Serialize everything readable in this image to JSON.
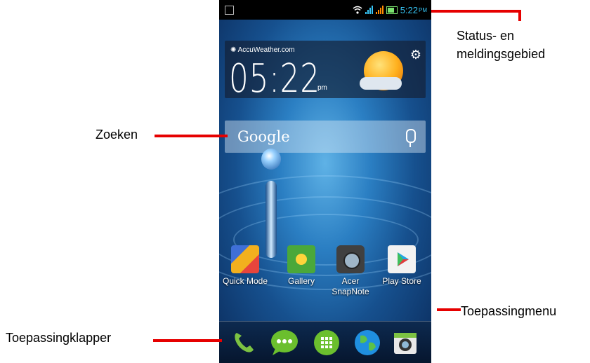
{
  "status_bar": {
    "time": "5:22",
    "ampm": "PM"
  },
  "widget": {
    "source": "AccuWeather.com",
    "time": "05:22",
    "suffix": "pm"
  },
  "search": {
    "label": "Google"
  },
  "apps": [
    {
      "label": "Quick Mode"
    },
    {
      "label": "Gallery"
    },
    {
      "label": "Acer SnapNote"
    },
    {
      "label": "Play Store"
    }
  ],
  "callouts": {
    "status": "Status- en meldingsgebied",
    "search": "Zoeken",
    "app_menu": "Toepassingmenu",
    "launcher": "Toepassingklapper"
  },
  "colors": {
    "callout_line": "#e60000",
    "status_time": "#36c4f4",
    "phone_icon": "#7cc242",
    "message_icon": "#6bbf2e"
  }
}
